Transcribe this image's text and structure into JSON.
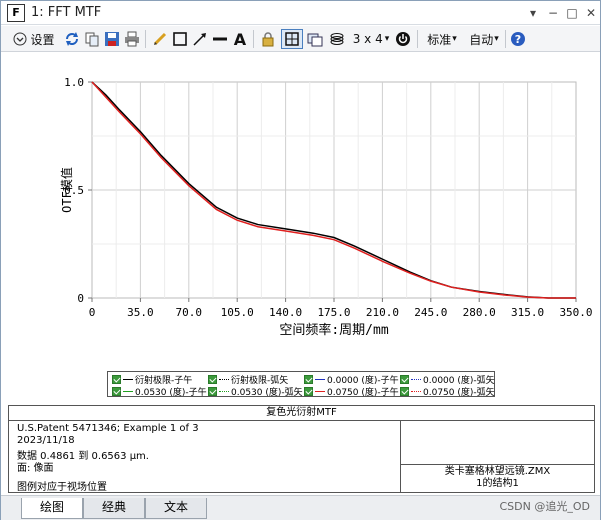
{
  "window": {
    "title": "1: FFT MTF",
    "app_icon_letter": "F"
  },
  "toolbar": {
    "settings_label": "设置",
    "layout_label": "3 x 4",
    "standard_label": "标准",
    "auto_label": "自动"
  },
  "chart_data": {
    "type": "line",
    "title": "",
    "xlabel": "空间频率:周期/mm",
    "ylabel": "OTF模值",
    "xlim": [
      0,
      350
    ],
    "ylim": [
      0,
      1
    ],
    "xticks": [
      "0",
      "35.0",
      "70.0",
      "105.0",
      "140.0",
      "175.0",
      "210.0",
      "245.0",
      "280.0",
      "315.0",
      "350.0"
    ],
    "yticks": [
      "0",
      "0.5",
      "1.0"
    ],
    "grid": true,
    "series": [
      {
        "name": "衍射极限-子午",
        "color": "#000000",
        "x": [
          0,
          10,
          20,
          35,
          50,
          70,
          90,
          105,
          120,
          140,
          160,
          175,
          190,
          210,
          230,
          245,
          260,
          280,
          300,
          315,
          330,
          350
        ],
        "y": [
          1.0,
          0.94,
          0.87,
          0.77,
          0.66,
          0.53,
          0.42,
          0.37,
          0.34,
          0.32,
          0.3,
          0.28,
          0.24,
          0.18,
          0.12,
          0.08,
          0.05,
          0.03,
          0.015,
          0.005,
          0.0,
          0.0
        ]
      },
      {
        "name": "0.0750 (度)-弧矢",
        "color": "#e0201f",
        "x": [
          0,
          10,
          20,
          35,
          50,
          70,
          90,
          105,
          120,
          140,
          160,
          175,
          190,
          210,
          230,
          245,
          260,
          280,
          300,
          315,
          330,
          350
        ],
        "y": [
          1.0,
          0.93,
          0.86,
          0.76,
          0.65,
          0.52,
          0.41,
          0.36,
          0.33,
          0.31,
          0.29,
          0.27,
          0.23,
          0.17,
          0.115,
          0.078,
          0.05,
          0.028,
          0.013,
          0.004,
          0.0,
          0.0
        ]
      }
    ]
  },
  "legend": {
    "items": [
      {
        "label": "衍射极限-子午",
        "color": "#000000",
        "dash": "solid"
      },
      {
        "label": "衍射极限-弧矢",
        "color": "#000000",
        "dash": "dotted"
      },
      {
        "label": "0.0000 (度)-子午",
        "color": "#2030c0",
        "dash": "solid"
      },
      {
        "label": "0.0000 (度)-弧矢",
        "color": "#2030c0",
        "dash": "dotted"
      },
      {
        "label": "0.0530 (度)-子午",
        "color": "#20a020",
        "dash": "solid"
      },
      {
        "label": "0.0530 (度)-弧矢",
        "color": "#20a020",
        "dash": "dotted"
      },
      {
        "label": "0.0750 (度)-子午",
        "color": "#e0201f",
        "dash": "solid"
      },
      {
        "label": "0.0750 (度)-弧矢",
        "color": "#e0201f",
        "dash": "dotted"
      }
    ]
  },
  "info": {
    "title": "复色光衍射MTF",
    "lines": [
      "U.S.Patent 5471346; Example 1 of 3",
      "2023/11/18",
      "数据 0.4861 到 0.6563 μm.",
      "面: 像面",
      "图例对应于视场位置"
    ],
    "file_name": "类卡塞格林望远镜.ZMX",
    "config": "1的结构1"
  },
  "tabs": [
    "绘图",
    "经典",
    "文本"
  ],
  "watermark": "CSDN @追光_OD"
}
